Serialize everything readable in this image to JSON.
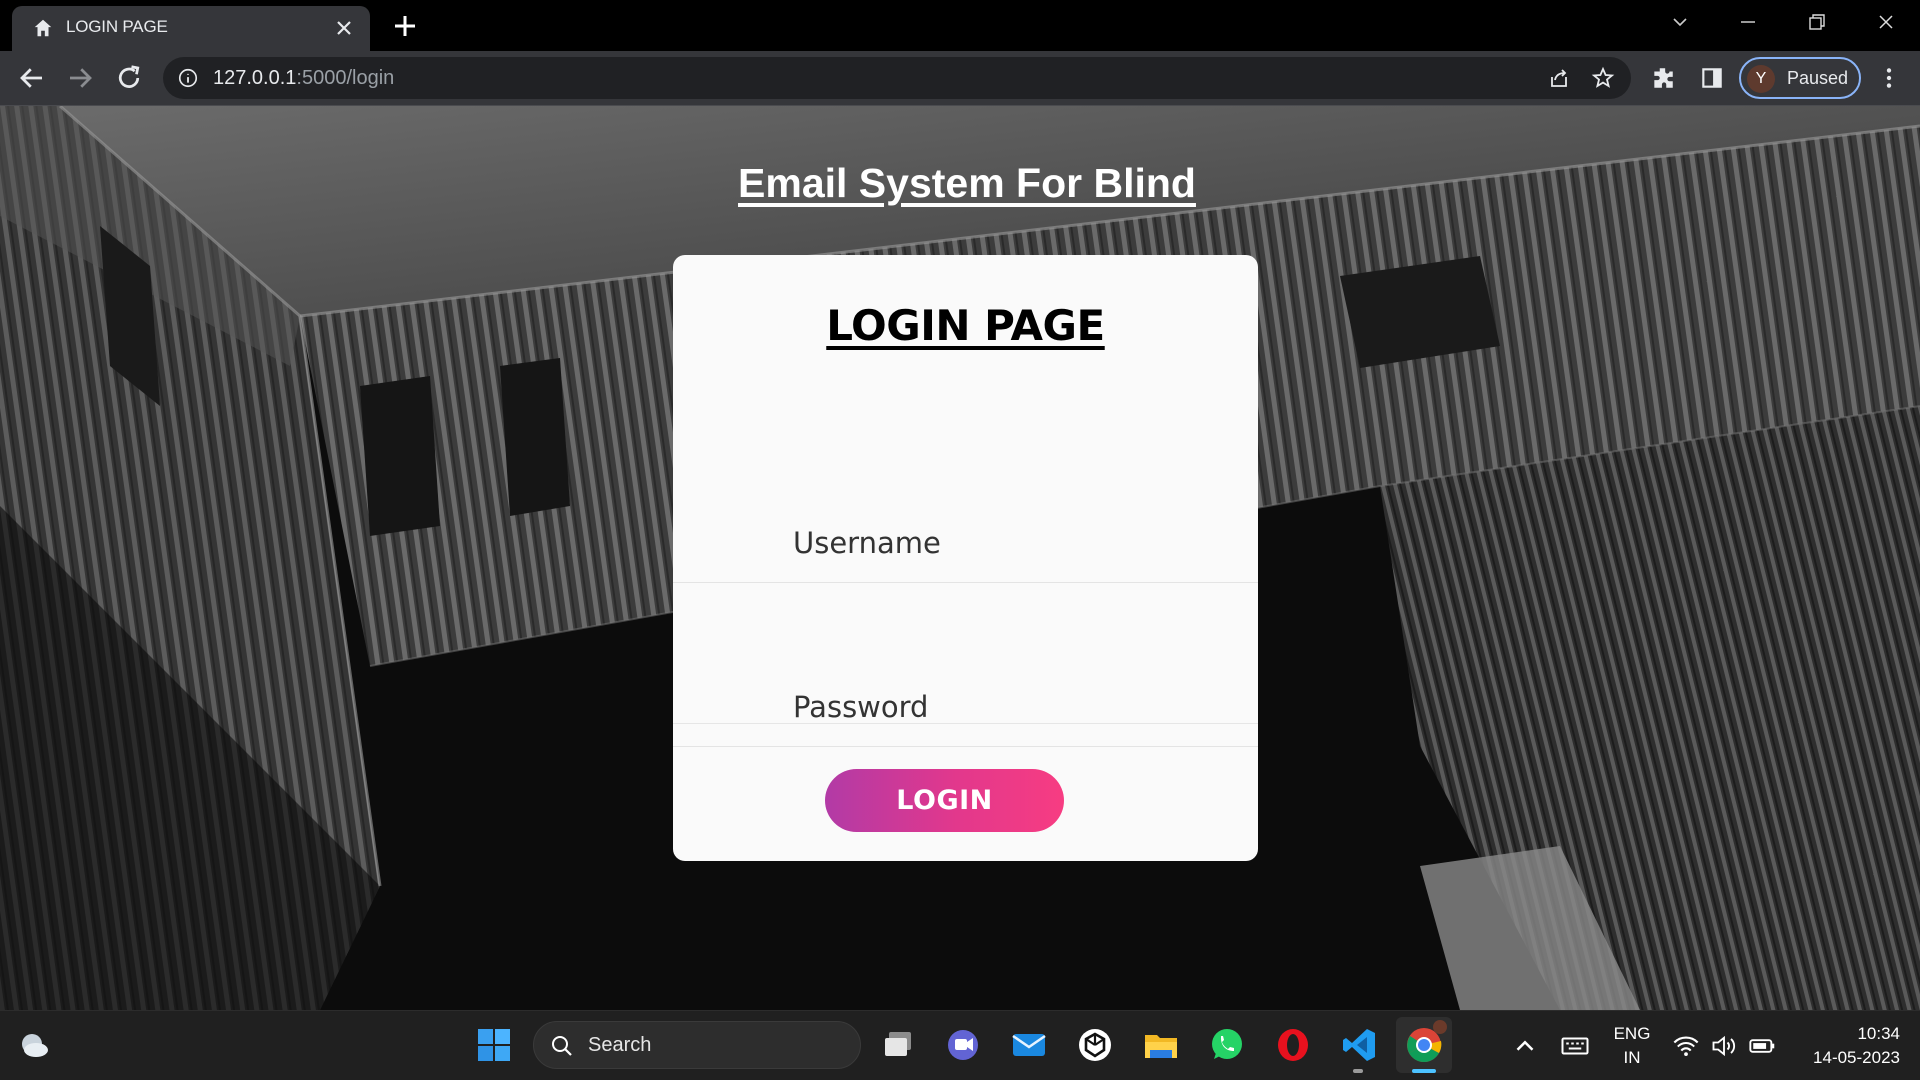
{
  "browser": {
    "tab_title": "LOGIN PAGE",
    "url_host": "127.0.0.1",
    "url_path": ":5000/login",
    "profile_initial": "Y",
    "profile_status": "Paused"
  },
  "page": {
    "site_title": "Email System For Blind",
    "card_title": "LOGIN PAGE",
    "username_placeholder": "Username",
    "password_placeholder": "Password",
    "login_label": "LOGIN"
  },
  "taskbar": {
    "search_label": "Search",
    "lang_top": "ENG",
    "lang_bottom": "IN",
    "time": "10:34",
    "date": "14-05-2023"
  },
  "colors": {
    "login_gradient_start": "#b23aa6",
    "login_gradient_end": "#f73c82",
    "card_bg": "#fafafa"
  }
}
